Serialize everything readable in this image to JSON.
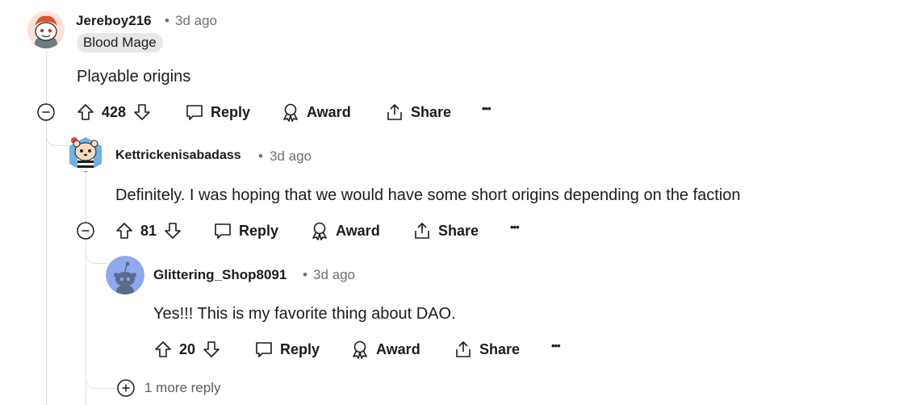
{
  "comments": [
    {
      "username": "Jereboy216",
      "age": "3d ago",
      "flair": "Blood Mage",
      "body": "Playable origins",
      "votes": "428",
      "reply_label": "Reply",
      "award_label": "Award",
      "share_label": "Share",
      "more_label": "•••"
    },
    {
      "username": "Kettrickenisabadass",
      "age": "3d ago",
      "body": "Definitely. I was hoping that we would have some short origins depending on the faction",
      "votes": "81",
      "reply_label": "Reply",
      "award_label": "Award",
      "share_label": "Share",
      "more_label": "•••"
    },
    {
      "username": "Glittering_Shop8091",
      "age": "3d ago",
      "body": "Yes!!! This is my favorite thing about DAO.",
      "votes": "20",
      "reply_label": "Reply",
      "award_label": "Award",
      "share_label": "Share",
      "more_label": "•••"
    }
  ],
  "more_replies": "1 more reply",
  "dot_separator": "•",
  "colors": {
    "text": "#1c1c1c",
    "meta": "#6f7072",
    "thread_line": "#e0e0e0",
    "flair_bg": "#e5e7e8",
    "avatar3_bg": "#8fa9f0"
  }
}
